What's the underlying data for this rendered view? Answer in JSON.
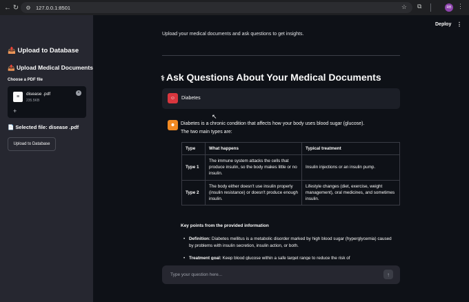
{
  "browser": {
    "url": "127.0.0.1:8501",
    "profile_initials": "RB"
  },
  "sidebar": {
    "title": "📤 Upload to Database",
    "section_title": "📤 Upload Medical Documents",
    "uploader_label": "Choose a PDF file",
    "file": {
      "name": "disease .pdf",
      "size": "235.5KB"
    },
    "selected_file_text": "📄 Selected file: disease .pdf",
    "upload_button_label": "Upload to Database"
  },
  "main": {
    "deploy_label": "Deploy",
    "intro_text": "Upload your medical documents and ask questions to get insights.",
    "heading": "Ask Questions About Your Medical Documents",
    "user_message": "Diabetes",
    "bot_intro_line1": "Diabetes is a chronic condition that affects how your body uses blood sugar (glucose).",
    "bot_intro_line2": "The two main types are:",
    "table": {
      "headers": [
        "Type",
        "What happens",
        "Typical treatment"
      ],
      "rows": [
        [
          "Type 1",
          "The immune system attacks the cells that produce insulin, so the body makes little or no insulin.",
          "Insulin injections or an insulin pump."
        ],
        [
          "Type 2",
          "The body either doesn't use insulin properly (insulin resistance) or doesn't produce enough insulin.",
          "Lifestyle changes (diet, exercise, weight management), oral medicines, and sometimes insulin."
        ]
      ]
    },
    "key_points_heading": "Key points from the provided information",
    "bullets": [
      {
        "label": "Definition:",
        "text": " Diabetes mellitus is a metabolic disorder marked by high blood sugar (hyperglycemia) caused by problems with insulin secretion, insulin action, or both."
      },
      {
        "label": "Treatment goal:",
        "text": " Keep blood glucose within a safe target range to reduce the risk of"
      }
    ],
    "chat_placeholder": "Type your question here..."
  },
  "colors": {
    "app_bg": "#0e1117",
    "sidebar_bg": "#262730",
    "user_avatar": "#d9363e",
    "assistant_avatar": "#f28a22"
  }
}
